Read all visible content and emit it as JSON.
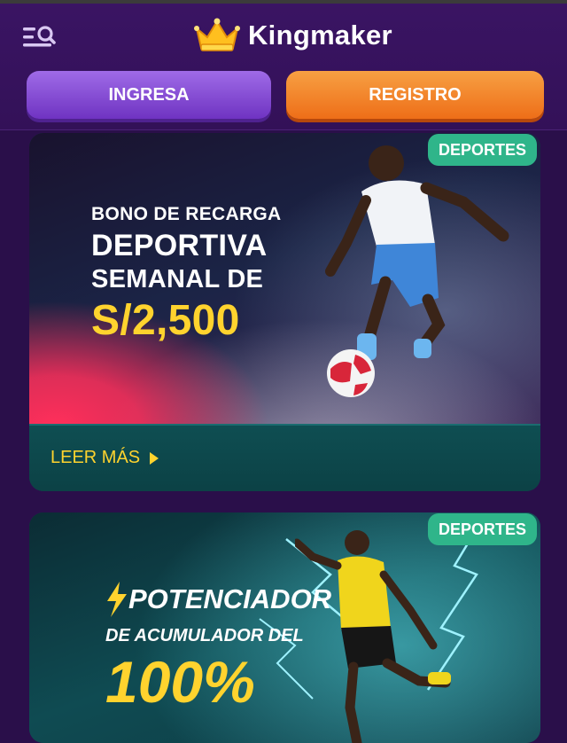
{
  "header": {
    "brand": "Kingmaker",
    "login_label": "INGRESA",
    "register_label": "REGISTRO",
    "icons": {
      "menu": "menu-search-icon",
      "logo": "crown-icon"
    }
  },
  "colors": {
    "background": "#2a0f4a",
    "login_button": "#8a52d8",
    "register_button": "#f08a2a",
    "badge": "#2fb58a",
    "accent_yellow": "#ffd32e",
    "card_footer": "#0e4e52"
  },
  "promos": [
    {
      "badge": "DEPORTES",
      "line1": "BONO DE RECARGA",
      "line2": "DEPORTIVA",
      "line3": "SEMANAL DE",
      "amount": "S/2,500",
      "read_more": "LEER MÁS"
    },
    {
      "badge": "DEPORTES",
      "line1": "POTENCIADOR",
      "line2": "DE ACUMULADOR DEL",
      "amount": "100%"
    }
  ]
}
